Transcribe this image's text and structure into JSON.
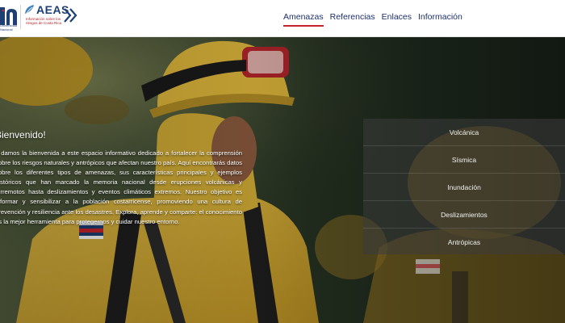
{
  "header": {
    "un_logo_text": "Universidad Nacional",
    "aeas_word": "AEAS",
    "aeas_tagline": "Información sobre los riesgos de Costa Rica"
  },
  "nav": {
    "items": [
      {
        "label": "Amenazas",
        "active": true
      },
      {
        "label": "Referencias",
        "active": false
      },
      {
        "label": "Enlaces",
        "active": false
      },
      {
        "label": "Información",
        "active": false
      }
    ]
  },
  "welcome": {
    "title": "Bienvenido!",
    "body": "e damos la bienvenida a este espacio informativo dedicado a fortalecer la comprensión sobre los riesgos naturales y antrópicos que afectan nuestro país. Aquí encontrarás datos sobre los diferentes tipos de amenazas, sus características principales y ejemplos históricos que han marcado la memoria nacional desde erupciones volcánicas y terremotos hasta deslizamientos y eventos climáticos extremos. Nuestro objetivo es informar y sensibilizar a la población costarricense, promoviendo una cultura de prevención y resiliencia ante los desastres. Explora, aprende y comparte: el conocimiento es la mejor herramienta para protegernos y cuidar nuestro entorno."
  },
  "threat_menu": {
    "items": [
      "Volcánica",
      "Sísmica",
      "Inundación",
      "Deslizamientos",
      "Antrópicas"
    ]
  },
  "colors": {
    "nav_text": "#1d2f6b",
    "nav_active_underline": "#c8242d",
    "logo_blue": "#1d3f73",
    "jacket_yellow": "#d8b43a",
    "menu_bg": "rgba(60,60,60,0.55)"
  }
}
